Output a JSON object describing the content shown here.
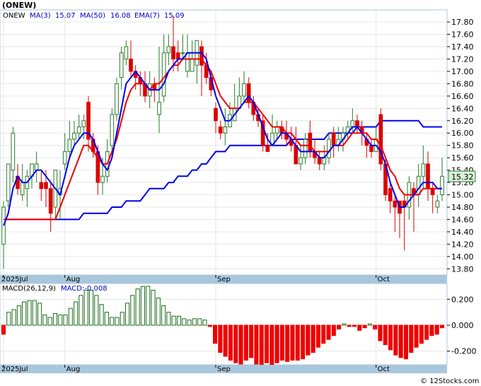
{
  "ticker": "(ONEW)",
  "legend": [
    {
      "label": "ONEW",
      "color": "#000000"
    },
    {
      "label": "MA(3)",
      "color": "#0000cc"
    },
    {
      "label": "15.07",
      "color": "#0000cc"
    },
    {
      "label": "MA(50)",
      "color": "#0000cc"
    },
    {
      "label": "16.08",
      "color": "#0000cc"
    },
    {
      "label": "EMA(7)",
      "color": "#0000cc"
    },
    {
      "label": "15.09",
      "color": "#0000cc"
    }
  ],
  "price_tag": "15.32",
  "macd_label": "MACD(26,12,9)",
  "macd_value_label": "MACD:-0.008",
  "watermark": "© 12Stocks.com",
  "colors": {
    "frame_blue": "#a9c7dc",
    "up": "#2a7a2a",
    "down": "#dd0000",
    "ma_fast": "#0000ee",
    "ema": "#ee0000",
    "ma_slow": "#0000ee",
    "macd_pos": "#1a6a1a",
    "macd_neg": "#ee0000"
  },
  "chart_data": [
    {
      "type": "candlestick",
      "ylim": [
        13.7,
        17.95
      ],
      "yticks": [
        "17.80",
        "17.60",
        "17.40",
        "17.20",
        "17.00",
        "16.80",
        "16.60",
        "16.40",
        "16.20",
        "16.00",
        "15.80",
        "15.60",
        "15.40",
        "15.20",
        "15.00",
        "14.80",
        "14.60",
        "14.40",
        "14.20",
        "14.00",
        "13.80"
      ],
      "x_labels": [
        {
          "i": 0,
          "label": "2025Jul"
        },
        {
          "i": 13,
          "label": "Aug"
        },
        {
          "i": 45,
          "label": "Sep"
        },
        {
          "i": 79,
          "label": "Oct"
        }
      ],
      "candles": [
        [
          14.2,
          14.8,
          14.9,
          13.8
        ],
        [
          14.9,
          15.5,
          15.5,
          14.8
        ],
        [
          15.4,
          16.0,
          16.1,
          15.2
        ],
        [
          15.3,
          15.1,
          15.5,
          15.0
        ],
        [
          15.0,
          15.2,
          15.5,
          14.9
        ],
        [
          15.1,
          15.3,
          15.4,
          14.8
        ],
        [
          15.3,
          15.5,
          15.5,
          15.1
        ],
        [
          15.4,
          15.5,
          15.7,
          15.2
        ],
        [
          15.2,
          15.1,
          15.4,
          14.9
        ],
        [
          15.2,
          15.1,
          15.4,
          14.8
        ],
        [
          15.1,
          14.7,
          15.2,
          14.4
        ],
        [
          14.8,
          15.4,
          15.4,
          14.6
        ],
        [
          15.0,
          15.1,
          15.4,
          14.6
        ],
        [
          15.5,
          15.7,
          16.0,
          15.4
        ],
        [
          15.7,
          15.9,
          16.2,
          15.6
        ],
        [
          15.9,
          16.0,
          16.2,
          15.8
        ],
        [
          16.0,
          16.1,
          16.3,
          15.9
        ],
        [
          16.1,
          16.2,
          16.3,
          15.9
        ],
        [
          16.5,
          15.9,
          16.6,
          15.7
        ],
        [
          15.9,
          15.7,
          16.0,
          15.6
        ],
        [
          15.7,
          15.2,
          15.8,
          15.0
        ],
        [
          15.2,
          15.3,
          15.6,
          15.0
        ],
        [
          15.3,
          15.7,
          15.9,
          15.2
        ],
        [
          15.8,
          16.3,
          16.4,
          15.6
        ],
        [
          16.3,
          16.8,
          16.9,
          16.2
        ],
        [
          16.9,
          17.3,
          17.4,
          16.7
        ],
        [
          17.2,
          17.4,
          17.5,
          17.1
        ],
        [
          17.2,
          17.0,
          17.5,
          16.9
        ],
        [
          17.0,
          16.9,
          17.1,
          16.7
        ],
        [
          16.9,
          16.8,
          17.0,
          16.6
        ],
        [
          16.8,
          16.6,
          17.0,
          16.5
        ],
        [
          16.6,
          16.8,
          17.0,
          16.4
        ],
        [
          16.8,
          16.7,
          16.9,
          16.5
        ],
        [
          16.3,
          16.5,
          17.4,
          16.0
        ],
        [
          16.6,
          17.3,
          17.6,
          16.5
        ],
        [
          17.3,
          17.4,
          17.6,
          17.1
        ],
        [
          17.4,
          17.2,
          17.9,
          17.0
        ],
        [
          17.3,
          17.2,
          17.5,
          17.0
        ],
        [
          17.3,
          17.3,
          17.6,
          17.2
        ],
        [
          17.0,
          17.3,
          17.6,
          16.9
        ],
        [
          17.0,
          17.2,
          17.5,
          17.0
        ],
        [
          17.1,
          17.5,
          17.5,
          16.8
        ],
        [
          17.4,
          17.1,
          17.5,
          16.6
        ],
        [
          17.1,
          16.9,
          17.3,
          16.8
        ],
        [
          16.9,
          16.7,
          17.0,
          16.6
        ],
        [
          16.4,
          16.2,
          16.5,
          16.0
        ],
        [
          16.1,
          16.0,
          16.2,
          15.9
        ],
        [
          16.0,
          16.1,
          16.4,
          15.8
        ],
        [
          16.1,
          16.3,
          16.5,
          16.1
        ],
        [
          16.2,
          16.4,
          16.8,
          16.2
        ],
        [
          16.4,
          16.6,
          16.9,
          16.4
        ],
        [
          16.6,
          16.8,
          17.0,
          16.5
        ],
        [
          16.8,
          16.5,
          16.9,
          16.4
        ],
        [
          16.5,
          16.3,
          16.6,
          16.2
        ],
        [
          16.3,
          16.2,
          16.4,
          16.1
        ],
        [
          16.2,
          15.8,
          16.3,
          15.7
        ],
        [
          15.8,
          15.7,
          16.0,
          15.7
        ],
        [
          15.8,
          16.0,
          16.3,
          15.8
        ],
        [
          16.0,
          16.1,
          16.2,
          15.9
        ],
        [
          16.1,
          16.0,
          16.2,
          15.9
        ],
        [
          16.0,
          15.9,
          16.2,
          15.8
        ],
        [
          15.9,
          15.8,
          16.1,
          15.7
        ],
        [
          15.8,
          15.5,
          16.1,
          15.5
        ],
        [
          15.5,
          15.6,
          15.8,
          15.4
        ],
        [
          15.6,
          15.9,
          16.0,
          15.5
        ],
        [
          16.0,
          15.7,
          16.2,
          15.6
        ],
        [
          15.7,
          15.6,
          15.9,
          15.5
        ],
        [
          15.6,
          15.5,
          15.7,
          15.4
        ],
        [
          15.5,
          15.6,
          15.8,
          15.4
        ],
        [
          15.6,
          15.9,
          16.0,
          15.5
        ],
        [
          16.0,
          15.8,
          16.1,
          15.6
        ],
        [
          15.8,
          15.9,
          16.1,
          15.7
        ],
        [
          15.9,
          16.0,
          16.1,
          15.7
        ],
        [
          16.0,
          16.1,
          16.2,
          15.9
        ],
        [
          16.1,
          16.2,
          16.4,
          16.0
        ],
        [
          16.2,
          16.1,
          16.3,
          16.0
        ],
        [
          16.1,
          16.0,
          16.2,
          15.8
        ],
        [
          15.9,
          15.8,
          16.0,
          15.6
        ],
        [
          15.8,
          15.7,
          15.9,
          15.6
        ],
        [
          15.7,
          15.9,
          16.1,
          15.7
        ],
        [
          16.3,
          15.5,
          16.4,
          15.4
        ],
        [
          15.5,
          15.0,
          15.6,
          14.9
        ],
        [
          15.1,
          14.9,
          15.2,
          14.7
        ],
        [
          14.9,
          14.8,
          15.0,
          14.4
        ],
        [
          14.9,
          14.7,
          14.8,
          14.3
        ],
        [
          14.9,
          14.8,
          15.0,
          14.1
        ],
        [
          14.8,
          15.2,
          15.3,
          14.6
        ],
        [
          15.1,
          15.0,
          15.2,
          14.4
        ],
        [
          15.0,
          15.3,
          15.5,
          14.8
        ],
        [
          15.3,
          15.5,
          15.8,
          15.1
        ],
        [
          15.5,
          15.1,
          15.7,
          14.9
        ],
        [
          15.1,
          15.0,
          15.2,
          14.7
        ],
        [
          14.8,
          14.9,
          15.0,
          14.7
        ],
        [
          15.0,
          15.3,
          15.6,
          14.9
        ]
      ],
      "ma_fast": [
        14.5,
        14.7,
        15.1,
        15.3,
        15.2,
        15.2,
        15.3,
        15.4,
        15.4,
        15.3,
        15.2,
        15.1,
        15.0,
        15.3,
        15.6,
        15.8,
        15.9,
        16.0,
        16.0,
        15.9,
        15.7,
        15.5,
        15.4,
        15.6,
        16.0,
        16.4,
        16.8,
        16.9,
        17.0,
        16.9,
        16.8,
        16.7,
        16.7,
        16.7,
        16.8,
        17.0,
        17.1,
        17.2,
        17.2,
        17.3,
        17.3,
        17.3,
        17.3,
        17.2,
        16.9,
        16.6,
        16.4,
        16.2,
        16.2,
        16.3,
        16.4,
        16.5,
        16.6,
        16.5,
        16.3,
        16.1,
        15.9,
        15.8,
        15.9,
        16.0,
        16.0,
        15.9,
        15.8,
        15.7,
        15.7,
        15.7,
        15.7,
        15.6,
        15.6,
        15.7,
        15.8,
        15.8,
        15.9,
        16.0,
        16.1,
        16.1,
        16.0,
        15.9,
        15.8,
        15.8,
        15.7,
        15.5,
        15.2,
        15.0,
        14.8,
        14.8,
        14.9,
        15.0,
        15.1,
        15.2,
        15.2,
        15.2,
        15.1,
        15.1
      ],
      "ema": [
        14.6,
        14.6,
        14.6,
        14.6,
        14.6,
        14.6,
        14.6,
        14.6,
        14.6,
        14.6,
        14.6,
        14.6,
        14.8,
        15.0,
        15.2,
        15.4,
        15.6,
        15.8,
        15.8,
        15.7,
        15.6,
        15.5,
        15.5,
        15.7,
        15.9,
        16.2,
        16.5,
        16.7,
        16.8,
        16.8,
        16.8,
        16.7,
        16.8,
        16.8,
        16.9,
        17.0,
        17.1,
        17.1,
        17.2,
        17.2,
        17.2,
        17.2,
        17.2,
        17.1,
        17.0,
        16.8,
        16.6,
        16.5,
        16.4,
        16.4,
        16.4,
        16.5,
        16.5,
        16.5,
        16.4,
        16.3,
        16.2,
        16.1,
        16.1,
        16.1,
        16.0,
        16.0,
        15.9,
        15.8,
        15.8,
        15.8,
        15.7,
        15.7,
        15.7,
        15.7,
        15.8,
        15.8,
        15.8,
        15.9,
        16.0,
        16.0,
        16.0,
        16.0,
        15.9,
        15.9,
        15.8,
        15.6,
        15.4,
        15.3,
        15.1,
        15.0,
        15.0,
        15.0,
        15.0,
        15.1,
        15.1,
        15.1,
        15.1,
        15.1
      ],
      "ma_slow": [
        14.6,
        14.6,
        14.6,
        14.6,
        14.6,
        14.6,
        14.6,
        14.6,
        14.6,
        14.6,
        14.6,
        14.6,
        14.6,
        14.6,
        14.6,
        14.6,
        14.6,
        14.7,
        14.7,
        14.7,
        14.7,
        14.7,
        14.7,
        14.8,
        14.8,
        14.8,
        14.9,
        14.9,
        14.9,
        14.9,
        15.0,
        15.1,
        15.1,
        15.1,
        15.1,
        15.2,
        15.2,
        15.3,
        15.3,
        15.3,
        15.4,
        15.4,
        15.5,
        15.5,
        15.6,
        15.7,
        15.7,
        15.7,
        15.8,
        15.8,
        15.8,
        15.8,
        15.8,
        15.8,
        15.8,
        15.8,
        15.8,
        15.8,
        15.8,
        15.8,
        15.8,
        15.9,
        15.9,
        15.9,
        15.9,
        15.9,
        15.9,
        15.9,
        15.9,
        16.0,
        16.0,
        16.0,
        16.0,
        16.0,
        16.0,
        16.1,
        16.1,
        16.1,
        16.1,
        16.1,
        16.2,
        16.2,
        16.2,
        16.2,
        16.2,
        16.2,
        16.2,
        16.2,
        16.2,
        16.1,
        16.1,
        16.1,
        16.1,
        16.1
      ]
    },
    {
      "type": "bar",
      "ylim": [
        -0.3,
        0.3
      ],
      "yticks": [
        "0.200",
        "0.000",
        "-0.200"
      ],
      "values": [
        -0.07,
        0.1,
        0.12,
        0.15,
        0.18,
        0.19,
        0.19,
        0.17,
        0.08,
        0.06,
        0.09,
        0.08,
        0.08,
        0.13,
        0.18,
        0.23,
        0.27,
        0.27,
        0.23,
        0.16,
        0.1,
        0.06,
        0.06,
        0.1,
        0.17,
        0.23,
        0.28,
        0.3,
        0.3,
        0.27,
        0.21,
        0.15,
        0.1,
        0.07,
        0.07,
        0.05,
        0.04,
        0.05,
        0.05,
        0.04,
        -0.01,
        -0.14,
        -0.21,
        -0.24,
        -0.27,
        -0.29,
        -0.3,
        -0.27,
        -0.25,
        -0.3,
        -0.34,
        -0.29,
        -0.31,
        -0.29,
        -0.27,
        -0.28,
        -0.27,
        -0.27,
        -0.26,
        -0.23,
        -0.21,
        -0.17,
        -0.14,
        -0.11,
        -0.08,
        -0.03,
        0.01,
        -0.01,
        -0.01,
        -0.04,
        -0.02,
        0.01,
        -0.03,
        -0.12,
        -0.15,
        -0.19,
        -0.23,
        -0.25,
        -0.26,
        -0.21,
        -0.17,
        -0.14,
        -0.11,
        -0.08,
        -0.07,
        -0.02
      ],
      "x_labels": [
        {
          "i": 0,
          "label": "2025Jul"
        },
        {
          "i": 13,
          "label": "Aug"
        },
        {
          "i": 45,
          "label": "Sep"
        },
        {
          "i": 79,
          "label": "Oct"
        }
      ]
    }
  ]
}
